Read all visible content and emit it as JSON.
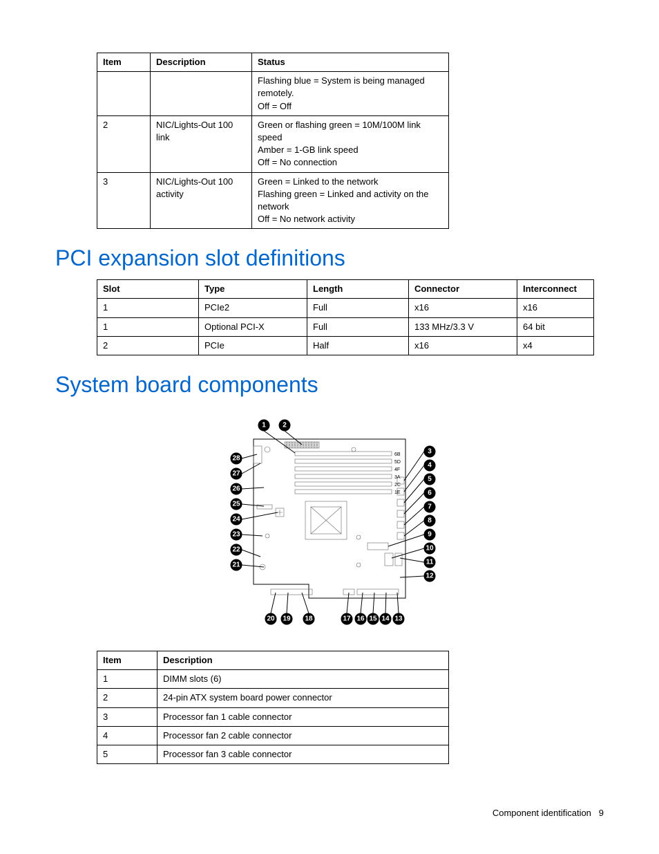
{
  "table1": {
    "headers": [
      "Item",
      "Description",
      "Status"
    ],
    "rows": [
      {
        "item": "",
        "desc": "",
        "status": "Flashing blue = System is being managed remotely.\nOff = Off"
      },
      {
        "item": "2",
        "desc": "NIC/Lights-Out 100 link",
        "status": "Green or flashing green = 10M/100M link speed\nAmber = 1-GB link speed\nOff = No connection"
      },
      {
        "item": "3",
        "desc": "NIC/Lights-Out 100 activity",
        "status": "Green = Linked to the network\nFlashing green = Linked and activity on the network\nOff = No network activity"
      }
    ]
  },
  "heading1": "PCI expansion slot definitions",
  "table2": {
    "headers": [
      "Slot",
      "Type",
      "Length",
      "Connector",
      "Interconnect"
    ],
    "rows": [
      {
        "c0": "1",
        "c1": "PCIe2",
        "c2": "Full",
        "c3": "x16",
        "c4": "x16"
      },
      {
        "c0": "1",
        "c1": "Optional PCI-X",
        "c2": "Full",
        "c3": "133 MHz/3.3 V",
        "c4": "64 bit"
      },
      {
        "c0": "2",
        "c1": "PCIe",
        "c2": "Half",
        "c3": "x16",
        "c4": "x4"
      }
    ]
  },
  "heading2": "System board components",
  "diagram": {
    "dimm_labels": [
      "6B",
      "5D",
      "4F",
      "3A",
      "2C",
      "1E"
    ],
    "callouts_top": [
      "1",
      "2"
    ],
    "callouts_left": [
      "28",
      "27",
      "26",
      "25",
      "24",
      "23",
      "22",
      "21"
    ],
    "callouts_right": [
      "3",
      "4",
      "5",
      "6",
      "7",
      "8",
      "9",
      "10",
      "11",
      "12"
    ],
    "callouts_bottom": [
      "20",
      "19",
      "18",
      "17",
      "16",
      "15",
      "14",
      "13"
    ]
  },
  "table3": {
    "headers": [
      "Item",
      "Description"
    ],
    "rows": [
      {
        "item": "1",
        "desc": "DIMM slots (6)"
      },
      {
        "item": "2",
        "desc": "24-pin ATX system board power connector"
      },
      {
        "item": "3",
        "desc": "Processor fan 1 cable connector"
      },
      {
        "item": "4",
        "desc": "Processor fan 2 cable connector"
      },
      {
        "item": "5",
        "desc": "Processor fan 3 cable connector"
      }
    ]
  },
  "footer": {
    "label": "Component identification",
    "page": "9"
  }
}
